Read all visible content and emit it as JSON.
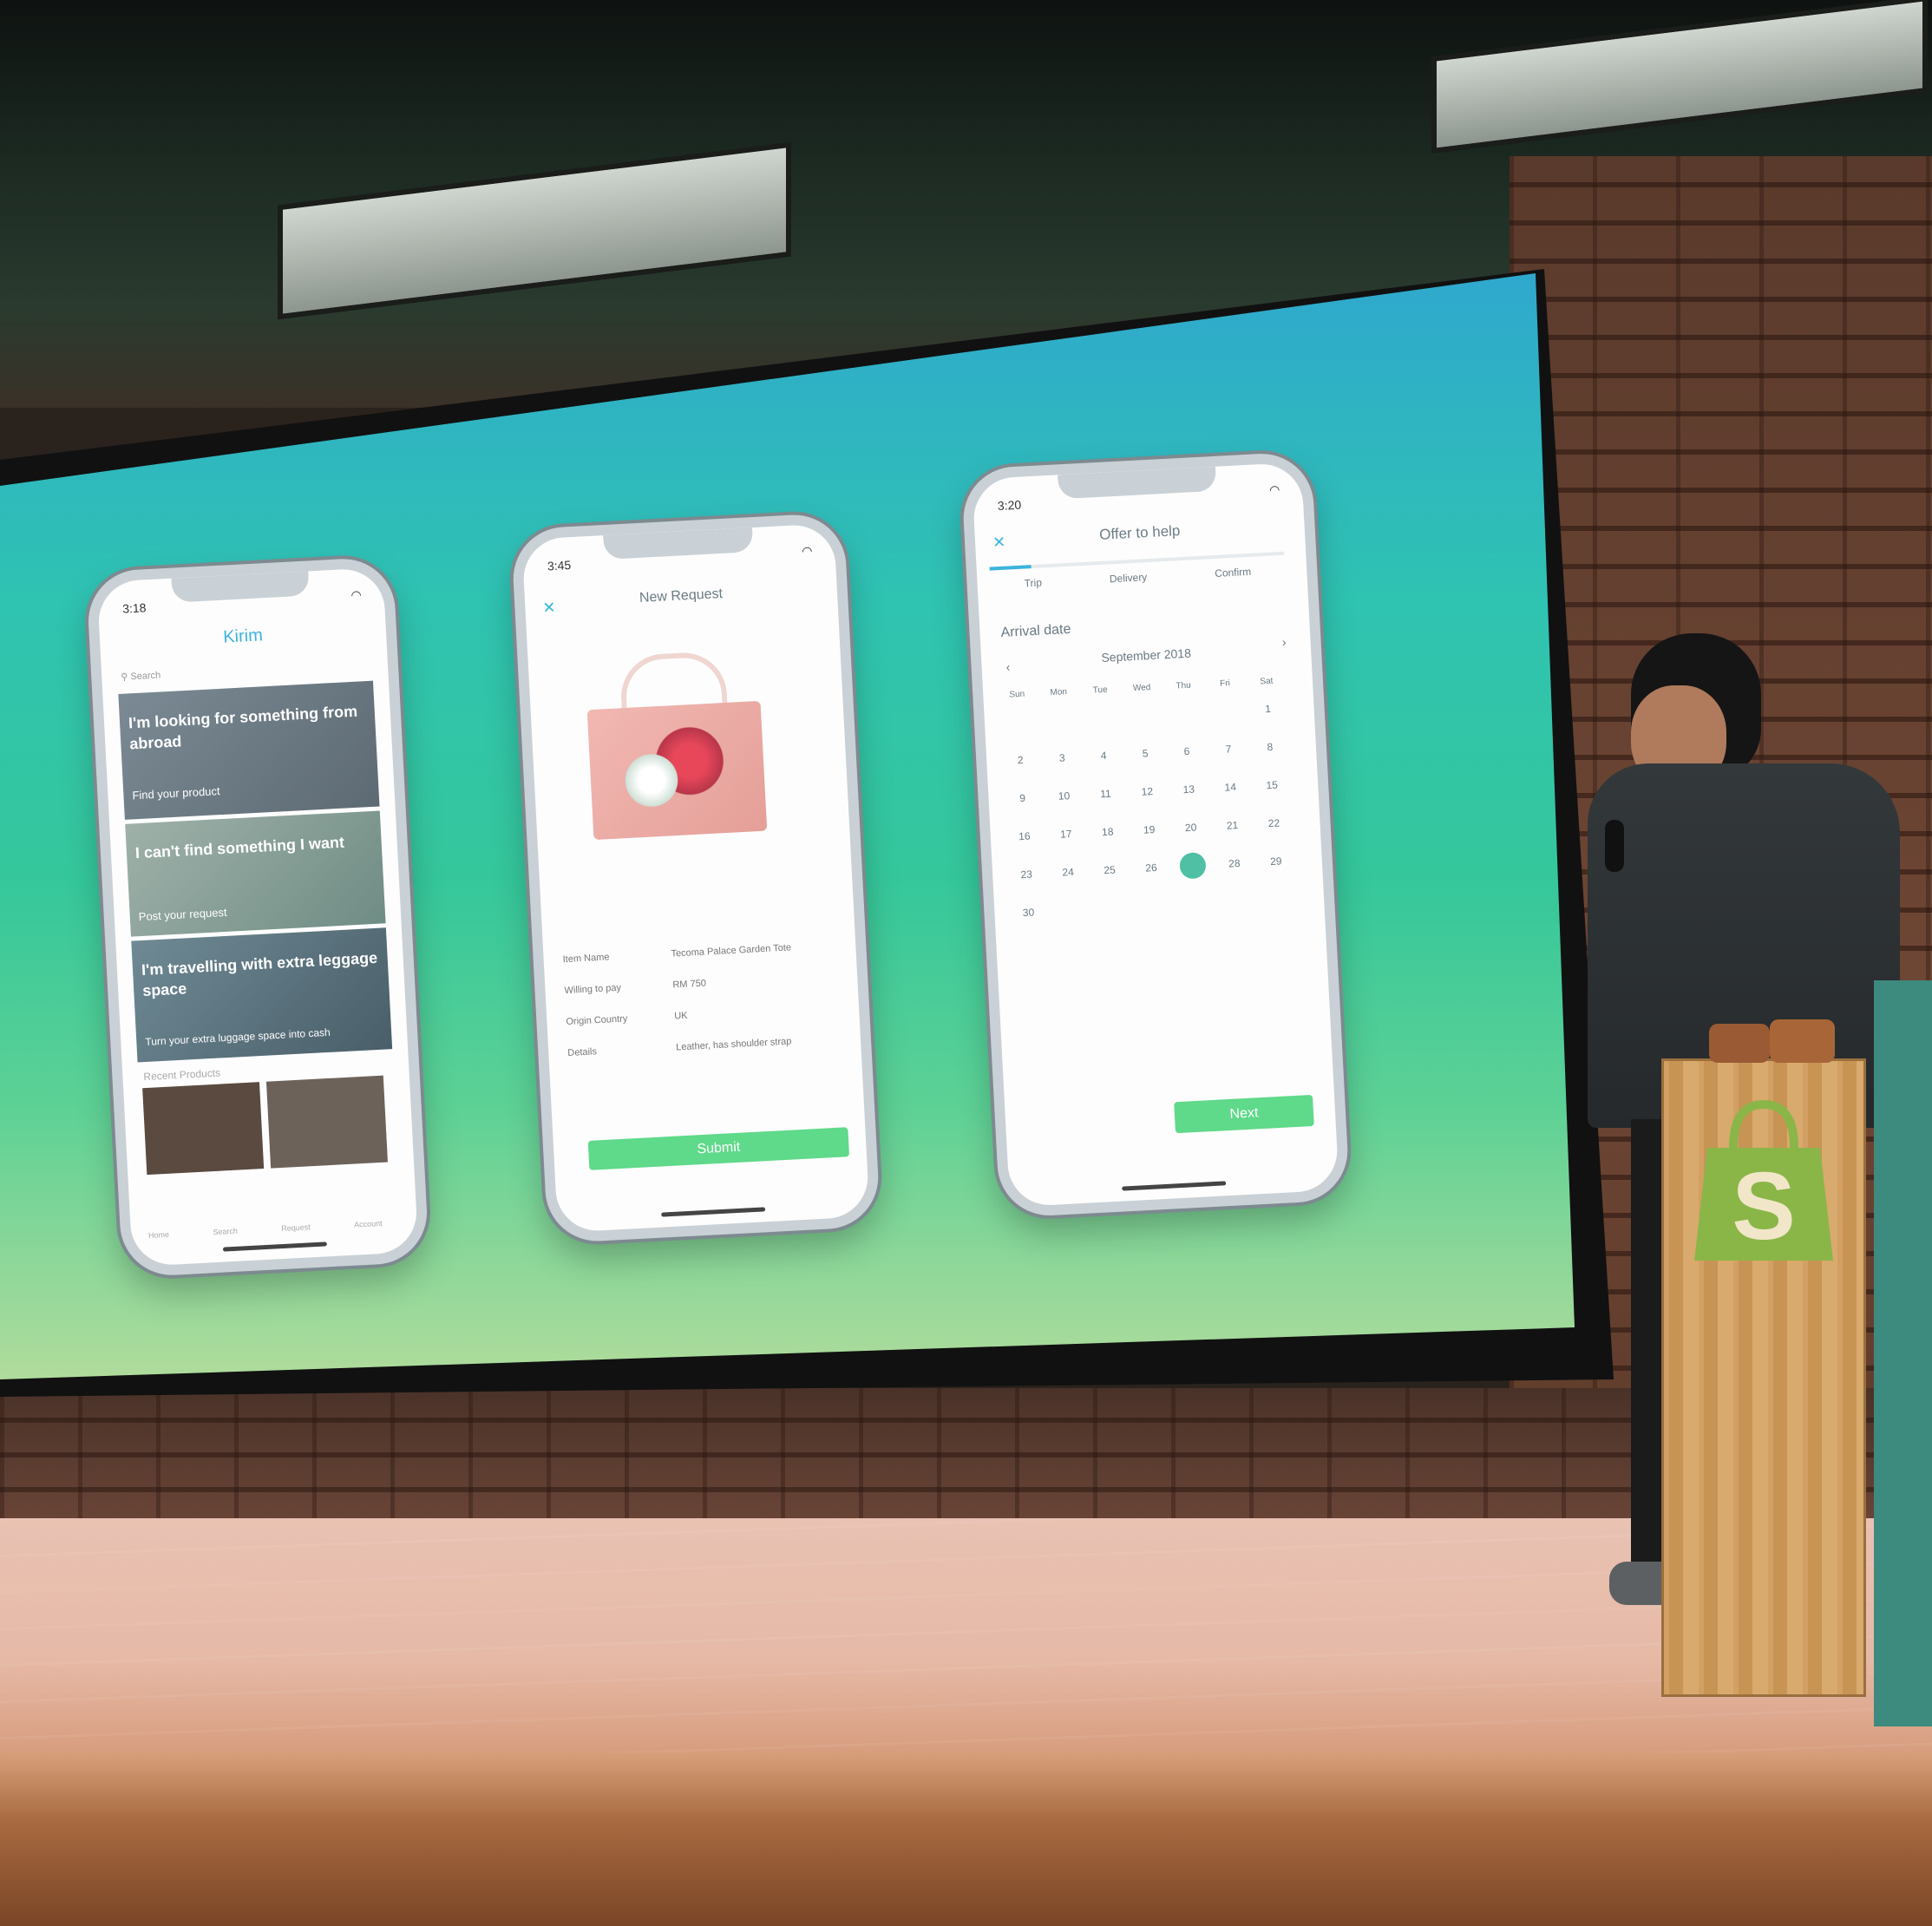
{
  "phones": {
    "home": {
      "time": "3:18",
      "app_title": "Kirim",
      "search_placeholder": "Search",
      "cards": [
        {
          "title": "I'm looking for something from abroad",
          "subtitle": "Find your product"
        },
        {
          "title": "I can't find something I want",
          "subtitle": "Post your request"
        },
        {
          "title": "I'm travelling with extra leggage space",
          "subtitle": "Turn your extra luggage space into cash"
        }
      ],
      "section_label": "Recent Products",
      "tabs": [
        "Home",
        "Search",
        "Request",
        "Account"
      ]
    },
    "request": {
      "time": "3:45",
      "title": "New Request",
      "fields": [
        {
          "label": "Item Name",
          "value": "Tecoma Palace Garden Tote"
        },
        {
          "label": "Willing to pay",
          "value": "RM 750"
        },
        {
          "label": "Origin Country",
          "value": "UK"
        },
        {
          "label": "Details",
          "value": "Leather, has shoulder strap"
        }
      ],
      "submit_label": "Submit"
    },
    "offer": {
      "time": "3:20",
      "title": "Offer to help",
      "steps": [
        "Trip",
        "Delivery",
        "Confirm"
      ],
      "section_label": "Arrival date",
      "month": "September 2018",
      "weekdays": [
        "Sun",
        "Mon",
        "Tue",
        "Wed",
        "Thu",
        "Fri",
        "Sat"
      ],
      "days": [
        "1",
        "2",
        "3",
        "4",
        "5",
        "6",
        "7",
        "8",
        "9",
        "10",
        "11",
        "12",
        "13",
        "14",
        "15",
        "16",
        "17",
        "18",
        "19",
        "20",
        "21",
        "22",
        "23",
        "24",
        "25",
        "26",
        "27",
        "28",
        "29",
        "30"
      ],
      "selected_day": "27",
      "next_label": "Next"
    }
  },
  "colors": {
    "accent_green": "#5fd98a",
    "accent_blue": "#3cb4dc",
    "slide_top": "#2fa7cf",
    "slide_bottom": "#b3dc9c"
  },
  "icons": {
    "close": "close-icon",
    "search": "search-icon",
    "wifi": "wifi-icon",
    "shopify_bag": "shopify-bag-icon"
  }
}
